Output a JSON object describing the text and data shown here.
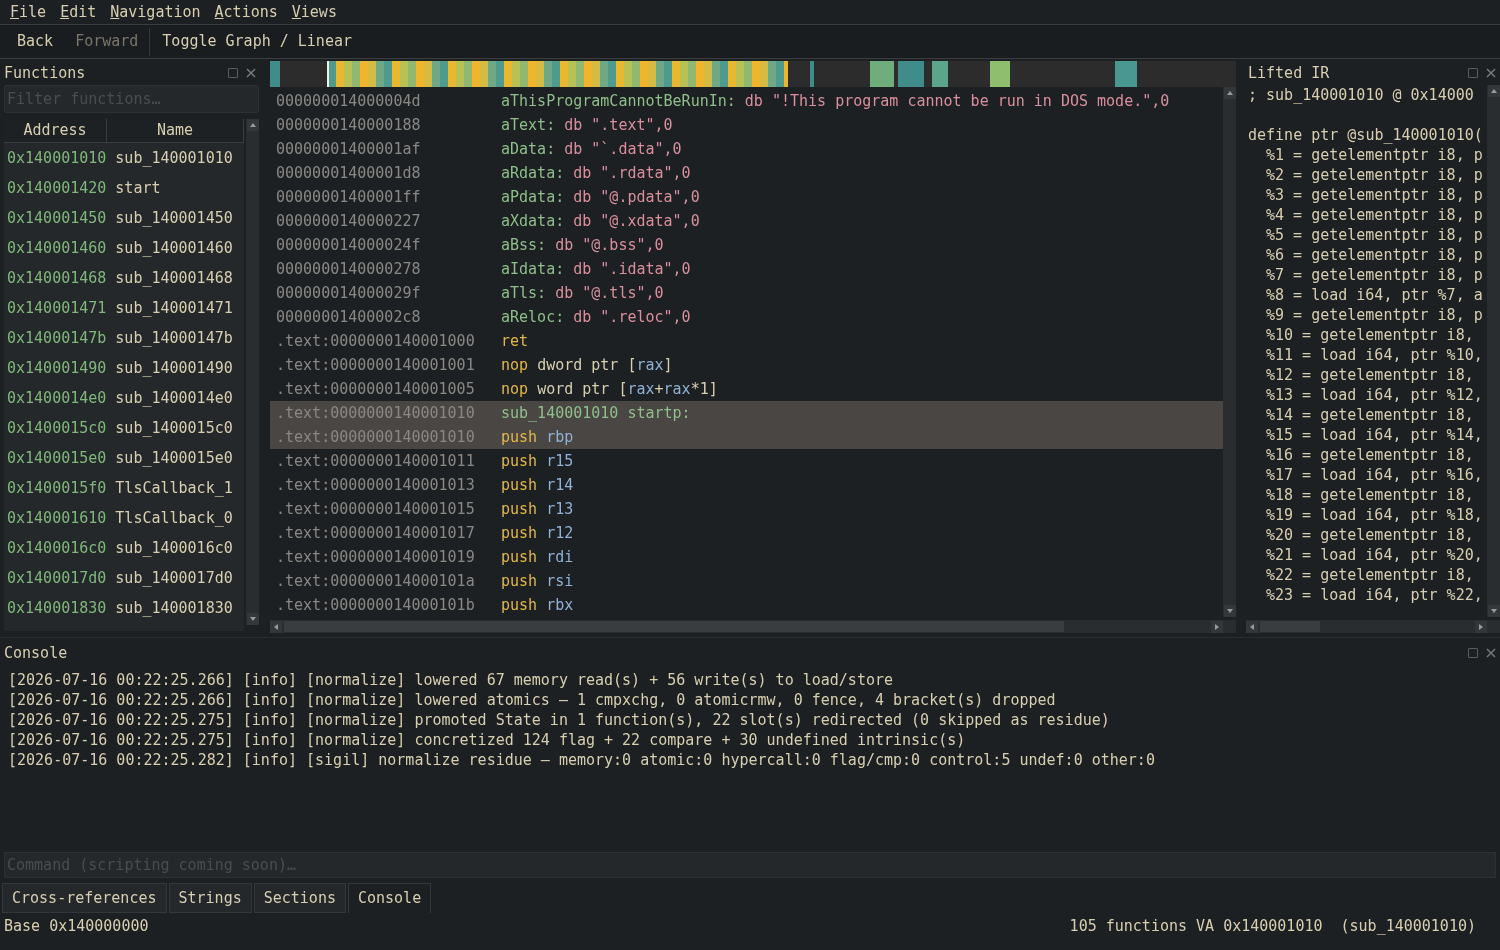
{
  "menu": [
    "File",
    "Edit",
    "Navigation",
    "Actions",
    "Views"
  ],
  "toolbar": [
    {
      "label": "Back",
      "disabled": false
    },
    {
      "label": "Forward",
      "disabled": true
    },
    {
      "label": "Toggle Graph / Linear",
      "disabled": false
    }
  ],
  "functions": {
    "title": "Functions",
    "filter_placeholder": "Filter functions…",
    "columns": [
      "Address",
      "Name"
    ],
    "rows": [
      {
        "address": "0x140001010",
        "name": "sub_140001010"
      },
      {
        "address": "0x140001420",
        "name": "start"
      },
      {
        "address": "0x140001450",
        "name": "sub_140001450"
      },
      {
        "address": "0x140001460",
        "name": "sub_140001460"
      },
      {
        "address": "0x140001468",
        "name": "sub_140001468"
      },
      {
        "address": "0x140001471",
        "name": "sub_140001471"
      },
      {
        "address": "0x14000147b",
        "name": "sub_14000147b"
      },
      {
        "address": "0x140001490",
        "name": "sub_140001490"
      },
      {
        "address": "0x1400014e0",
        "name": "sub_1400014e0"
      },
      {
        "address": "0x1400015c0",
        "name": "sub_1400015c0"
      },
      {
        "address": "0x1400015e0",
        "name": "sub_1400015e0"
      },
      {
        "address": "0x1400015f0",
        "name": "TlsCallback_1"
      },
      {
        "address": "0x140001610",
        "name": "TlsCallback_0"
      },
      {
        "address": "0x1400016c0",
        "name": "sub_1400016c0"
      },
      {
        "address": "0x1400017d0",
        "name": "sub_1400017d0"
      },
      {
        "address": "0x140001830",
        "name": "sub_140001830"
      }
    ]
  },
  "disassembly": [
    {
      "address": "000000014000004d",
      "selected": false,
      "tokens": [
        {
          "kind": "label",
          "t": "aThisProgramCannotBeRunIn: "
        },
        {
          "kind": "string",
          "t": "db \"!This program cannot be run in DOS mode.\",0"
        }
      ]
    },
    {
      "address": "0000000140000188",
      "selected": false,
      "tokens": [
        {
          "kind": "label",
          "t": "aText: "
        },
        {
          "kind": "string",
          "t": "db \".text\",0"
        }
      ]
    },
    {
      "address": "00000001400001af",
      "selected": false,
      "tokens": [
        {
          "kind": "label",
          "t": "aData: "
        },
        {
          "kind": "string",
          "t": "db \"`.data\",0"
        }
      ]
    },
    {
      "address": "00000001400001d8",
      "selected": false,
      "tokens": [
        {
          "kind": "label",
          "t": "aRdata: "
        },
        {
          "kind": "string",
          "t": "db \".rdata\",0"
        }
      ]
    },
    {
      "address": "00000001400001ff",
      "selected": false,
      "tokens": [
        {
          "kind": "label",
          "t": "aPdata: "
        },
        {
          "kind": "string",
          "t": "db \"@.pdata\",0"
        }
      ]
    },
    {
      "address": "0000000140000227",
      "selected": false,
      "tokens": [
        {
          "kind": "label",
          "t": "aXdata: "
        },
        {
          "kind": "string",
          "t": "db \"@.xdata\",0"
        }
      ]
    },
    {
      "address": "000000014000024f",
      "selected": false,
      "tokens": [
        {
          "kind": "label",
          "t": "aBss: "
        },
        {
          "kind": "string",
          "t": "db \"@.bss\",0"
        }
      ]
    },
    {
      "address": "0000000140000278",
      "selected": false,
      "tokens": [
        {
          "kind": "label",
          "t": "aIdata: "
        },
        {
          "kind": "string",
          "t": "db \".idata\",0"
        }
      ]
    },
    {
      "address": "000000014000029f",
      "selected": false,
      "tokens": [
        {
          "kind": "label",
          "t": "aTls: "
        },
        {
          "kind": "string",
          "t": "db \"@.tls\",0"
        }
      ]
    },
    {
      "address": "00000001400002c8",
      "selected": false,
      "tokens": [
        {
          "kind": "label",
          "t": "aReloc: "
        },
        {
          "kind": "string",
          "t": "db \".reloc\",0"
        }
      ]
    },
    {
      "address": ".text:0000000140001000",
      "selected": false,
      "tokens": [
        {
          "kind": "mnemonic",
          "t": "ret"
        }
      ]
    },
    {
      "address": ".text:0000000140001001",
      "selected": false,
      "tokens": [
        {
          "kind": "mnemonic",
          "t": "nop "
        },
        {
          "kind": "plain",
          "t": "dword ptr ["
        },
        {
          "kind": "reg",
          "t": "rax"
        },
        {
          "kind": "plain",
          "t": "]"
        }
      ]
    },
    {
      "address": ".text:0000000140001005",
      "selected": false,
      "tokens": [
        {
          "kind": "mnemonic",
          "t": "nop "
        },
        {
          "kind": "plain",
          "t": "word ptr ["
        },
        {
          "kind": "reg",
          "t": "rax"
        },
        {
          "kind": "plain",
          "t": "+"
        },
        {
          "kind": "reg",
          "t": "rax"
        },
        {
          "kind": "plain",
          "t": "*1]"
        }
      ]
    },
    {
      "address": ".text:0000000140001010",
      "selected": true,
      "tokens": [
        {
          "kind": "label",
          "t": "sub_140001010 startp:"
        }
      ]
    },
    {
      "address": ".text:0000000140001010",
      "selected": true,
      "tokens": [
        {
          "kind": "mnemonic",
          "t": "push "
        },
        {
          "kind": "reg",
          "t": "rbp"
        }
      ]
    },
    {
      "address": ".text:0000000140001011",
      "selected": false,
      "tokens": [
        {
          "kind": "mnemonic",
          "t": "push "
        },
        {
          "kind": "reg",
          "t": "r15"
        }
      ]
    },
    {
      "address": ".text:0000000140001013",
      "selected": false,
      "tokens": [
        {
          "kind": "mnemonic",
          "t": "push "
        },
        {
          "kind": "reg",
          "t": "r14"
        }
      ]
    },
    {
      "address": ".text:0000000140001015",
      "selected": false,
      "tokens": [
        {
          "kind": "mnemonic",
          "t": "push "
        },
        {
          "kind": "reg",
          "t": "r13"
        }
      ]
    },
    {
      "address": ".text:0000000140001017",
      "selected": false,
      "tokens": [
        {
          "kind": "mnemonic",
          "t": "push "
        },
        {
          "kind": "reg",
          "t": "r12"
        }
      ]
    },
    {
      "address": ".text:0000000140001019",
      "selected": false,
      "tokens": [
        {
          "kind": "mnemonic",
          "t": "push "
        },
        {
          "kind": "reg",
          "t": "rdi"
        }
      ]
    },
    {
      "address": ".text:000000014000101a",
      "selected": false,
      "tokens": [
        {
          "kind": "mnemonic",
          "t": "push "
        },
        {
          "kind": "reg",
          "t": "rsi"
        }
      ]
    },
    {
      "address": ".text:000000014000101b",
      "selected": false,
      "tokens": [
        {
          "kind": "mnemonic",
          "t": "push "
        },
        {
          "kind": "reg",
          "t": "rbx"
        }
      ]
    }
  ],
  "lifted_ir": {
    "title": "Lifted IR",
    "header": "; sub_140001010  @ 0x14000",
    "define": "define ptr @sub_140001010(",
    "lines": [
      "%1 = getelementptr i8, p",
      "%2 = getelementptr i8, p",
      "%3 = getelementptr i8, p",
      "%4 = getelementptr i8, p",
      "%5 = getelementptr i8, p",
      "%6 = getelementptr i8, p",
      "%7 = getelementptr i8, p",
      "%8 = load i64, ptr %7, a",
      "%9 = getelementptr i8, p",
      "%10 = getelementptr i8,",
      "%11 = load i64, ptr %10,",
      "%12 = getelementptr i8,",
      "%13 = load i64, ptr %12,",
      "%14 = getelementptr i8,",
      "%15 = load i64, ptr %14,",
      "%16 = getelementptr i8,",
      "%17 = load i64, ptr %16,",
      "%18 = getelementptr i8,",
      "%19 = load i64, ptr %18,",
      "%20 = getelementptr i8,",
      "%21 = load i64, ptr %20,",
      "%22 = getelementptr i8,",
      "%23 = load i64, ptr %22,"
    ]
  },
  "console": {
    "title": "Console",
    "lines": [
      "[2026-07-16 00:22:25.266] [info] [normalize] lowered 67 memory read(s) + 56 write(s) to load/store",
      "[2026-07-16 00:22:25.266] [info] [normalize] lowered atomics — 1 cmpxchg, 0 atomicrmw, 0 fence, 4 bracket(s) dropped",
      "[2026-07-16 00:22:25.275] [info] [normalize] promoted State in 1 function(s), 22 slot(s) redirected (0 skipped as residue)",
      "[2026-07-16 00:22:25.275] [info] [normalize] concretized 124 flag + 22 compare + 30 undefined intrinsic(s)",
      "[2026-07-16 00:22:25.282] [info] [sigil] normalize residue — memory:0 atomic:0 hypercall:0 flag/cmp:0 control:5 undef:0 other:0"
    ],
    "command_placeholder": "Command (scripting coming soon)…"
  },
  "bottom_tabs": [
    {
      "label": "Cross-references",
      "selected": false
    },
    {
      "label": "Strings",
      "selected": false
    },
    {
      "label": "Sections",
      "selected": false
    },
    {
      "label": "Console",
      "selected": true
    }
  ],
  "status": {
    "left": "Base 0x140000000",
    "right": "105 functions VA 0x140001010  (sub_140001010)"
  }
}
